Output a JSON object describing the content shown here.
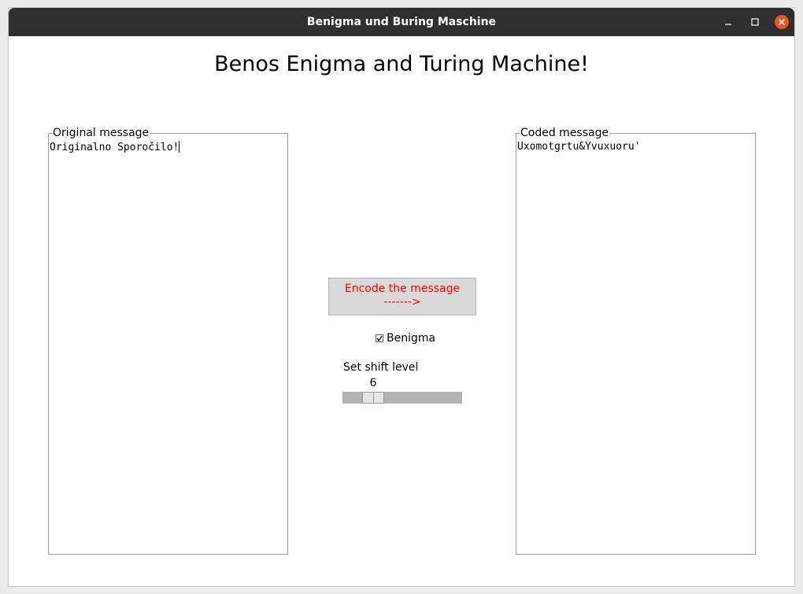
{
  "window": {
    "title": "Benigma und Buring Maschine"
  },
  "app": {
    "title": "Benos Enigma and Turing Machine!"
  },
  "original": {
    "legend": "Original message",
    "text": "Originalno Sporočilo!"
  },
  "coded": {
    "legend": "Coded message",
    "text": "Uxomotgrtu&Yvuxuoru'"
  },
  "encode_button": {
    "line1": "Encode the message",
    "line2": "------->",
    "color": "#ff0000"
  },
  "benigma_checkbox": {
    "label": "Benigma",
    "checked": true
  },
  "shift": {
    "label": "Set shift level",
    "value": "6",
    "fraction": 0.2
  },
  "icons": [
    "minimize-icon",
    "maximize-icon",
    "close-icon",
    "checkmark-icon"
  ]
}
